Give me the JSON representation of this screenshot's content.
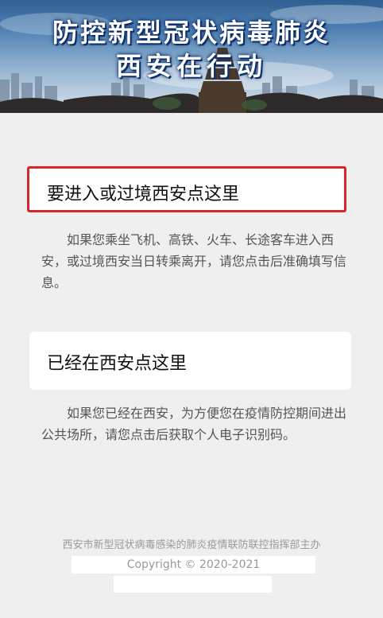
{
  "banner": {
    "title_line1": "防控新型冠状病毒肺炎",
    "title_line2": "西安在行动"
  },
  "options": [
    {
      "label": "要进入或过境西安点这里",
      "description": "如果您乘坐飞机、高铁、火车、长途客车进入西安，或过境西安当日转乘离开，请您点击后准确填写信息。",
      "highlighted": true,
      "highlight_color": "#d9252a"
    },
    {
      "label": "已经在西安点这里",
      "description": "如果您已经在西安，为方便您在疫情防控期间进出公共场所，请您点击后获取个人电子识别码。",
      "highlighted": false
    }
  ],
  "footer": {
    "organizer": "西安市新型冠状病毒感染的肺炎疫情联防联控指挥部主办",
    "copyright": "Copyright © 2020-2021"
  },
  "colors": {
    "page_background": "#efefef",
    "card_background": "#ffffff",
    "banner_text": "#ffffff"
  }
}
